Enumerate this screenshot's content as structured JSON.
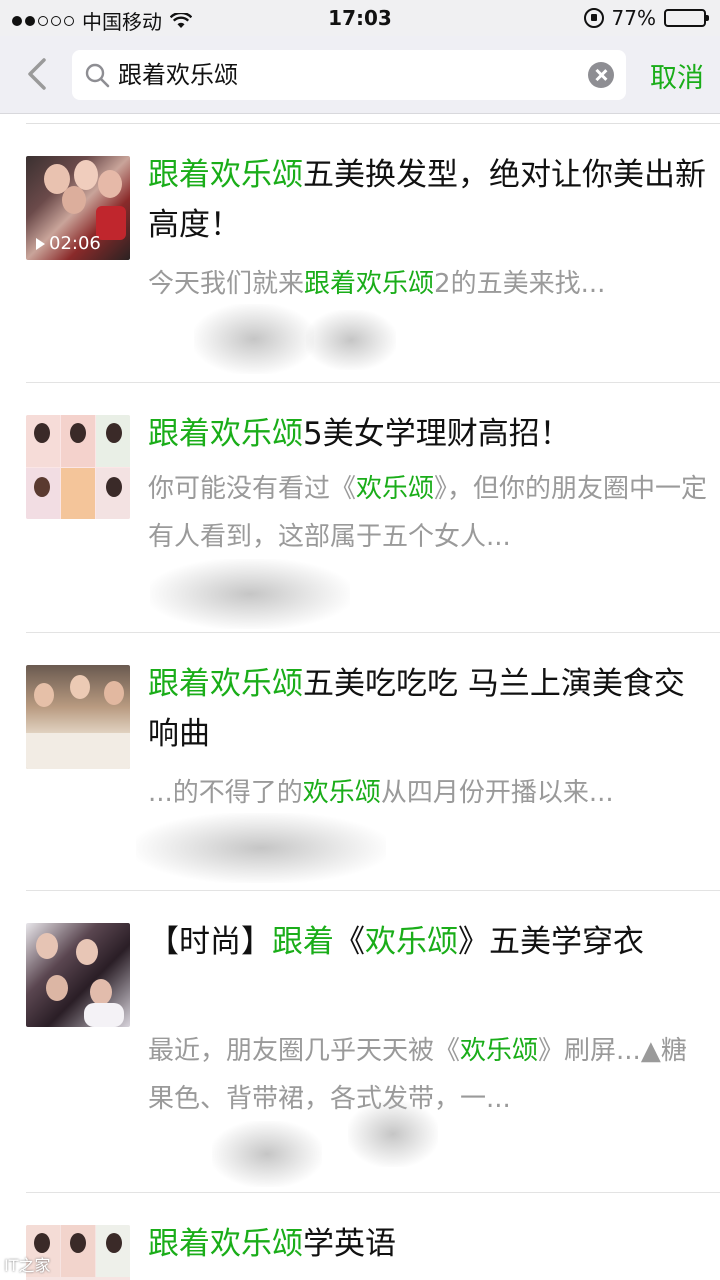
{
  "status": {
    "carrier": "中国移动",
    "time": "17:03",
    "battery": "77%",
    "battery_level": 0.77
  },
  "search": {
    "query": "跟着欢乐颂",
    "cancel_label": "取消"
  },
  "results": [
    {
      "title_parts": [
        {
          "t": "跟着欢乐颂",
          "hl": true
        },
        {
          "t": "五美换发型，绝对让你美出新高度！",
          "hl": false
        }
      ],
      "snippet_parts": [
        {
          "t": "今天我们就来",
          "hl": false
        },
        {
          "t": "跟着欢乐颂",
          "hl": true
        },
        {
          "t": "2的五美来找...",
          "hl": false
        }
      ],
      "duration": "02:06"
    },
    {
      "title_parts": [
        {
          "t": "跟着欢乐颂",
          "hl": true
        },
        {
          "t": "5美女学理财高招！",
          "hl": false
        }
      ],
      "snippet_parts": [
        {
          "t": "你可能没有看过《",
          "hl": false
        },
        {
          "t": "欢乐颂",
          "hl": true
        },
        {
          "t": "》，但你的朋友圈中一定有人看到，这部属于五个女人...",
          "hl": false
        }
      ]
    },
    {
      "title_parts": [
        {
          "t": "跟着欢乐颂",
          "hl": true
        },
        {
          "t": "五美吃吃吃 马兰上演美食交响曲",
          "hl": false
        }
      ],
      "snippet_parts": [
        {
          "t": "...的不得了的",
          "hl": false
        },
        {
          "t": "欢乐颂",
          "hl": true
        },
        {
          "t": "从四月份开播以来...",
          "hl": false
        }
      ]
    },
    {
      "title_parts": [
        {
          "t": "【时尚】",
          "hl": false
        },
        {
          "t": "跟着",
          "hl": true
        },
        {
          "t": "《",
          "hl": false
        },
        {
          "t": "欢乐颂",
          "hl": true
        },
        {
          "t": "》五美学穿衣",
          "hl": false
        }
      ],
      "snippet_parts": [
        {
          "t": "最近，朋友圈几乎天天被《",
          "hl": false
        },
        {
          "t": "欢乐颂",
          "hl": true
        },
        {
          "t": "》刷屏...▲糖果色、背带裙，各式发带，一...",
          "hl": false
        }
      ]
    },
    {
      "title_parts": [
        {
          "t": "跟着欢乐颂",
          "hl": true
        },
        {
          "t": "学英语",
          "hl": false
        }
      ],
      "snippet_parts": []
    }
  ],
  "watermark": "IT之家"
}
